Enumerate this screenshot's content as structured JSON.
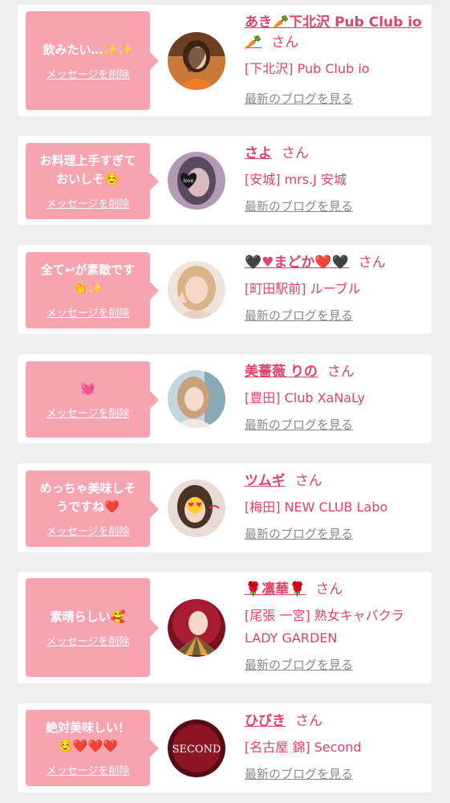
{
  "delete_label": "メッセージを削除",
  "san_label": "さん",
  "blog_label": "最新のブログを見る",
  "colors": {
    "background": "#eeeeee",
    "card": "#ffffff",
    "bubble": "#f7a3b0",
    "name": "#e0436a",
    "blog_link": "#8a8a8a"
  },
  "messages": [
    {
      "message": "飲みたい…✨✨",
      "name": "あき🥕下北沢 Pub Club io🥕",
      "shop": "[下北沢] Pub Club io",
      "avatar_icon": "woman-portrait-orange"
    },
    {
      "message": "お料理上手すぎて\nおいしそ☺️",
      "name": "さよ",
      "shop": "[安城] mrs.J 安城",
      "avatar_icon": "woman-portrait-heart-sticker"
    },
    {
      "message": "全て↩︎が素敵です\n👏✨",
      "name": "🖤♥まどか❤️🖤",
      "shop": "[町田駅前] ルーブル",
      "avatar_icon": "woman-portrait-blonde"
    },
    {
      "message": "💓",
      "name": "美薔薇 りの",
      "shop": "[豊田] Club XaNaLy",
      "avatar_icon": "woman-portrait-light"
    },
    {
      "message": "めっちゃ美味しそ\nうですね❤️",
      "name": "ツムギ",
      "shop": "[梅田] NEW CLUB Labo",
      "avatar_icon": "woman-portrait-heart-eyes"
    },
    {
      "message": "素晴らしい🥰",
      "name": "🌹凛華🌹",
      "shop": "[尾張 一宮] 熟女キャバクラ LADY GARDEN",
      "avatar_icon": "woman-portrait-fan"
    },
    {
      "message": "絶対美味しい！\n☺️❤️❤️❤️",
      "name": "ひびき",
      "shop": "[名古屋 錦] Second",
      "avatar_icon": "second-logo",
      "avatar_text": "SECOND"
    }
  ]
}
